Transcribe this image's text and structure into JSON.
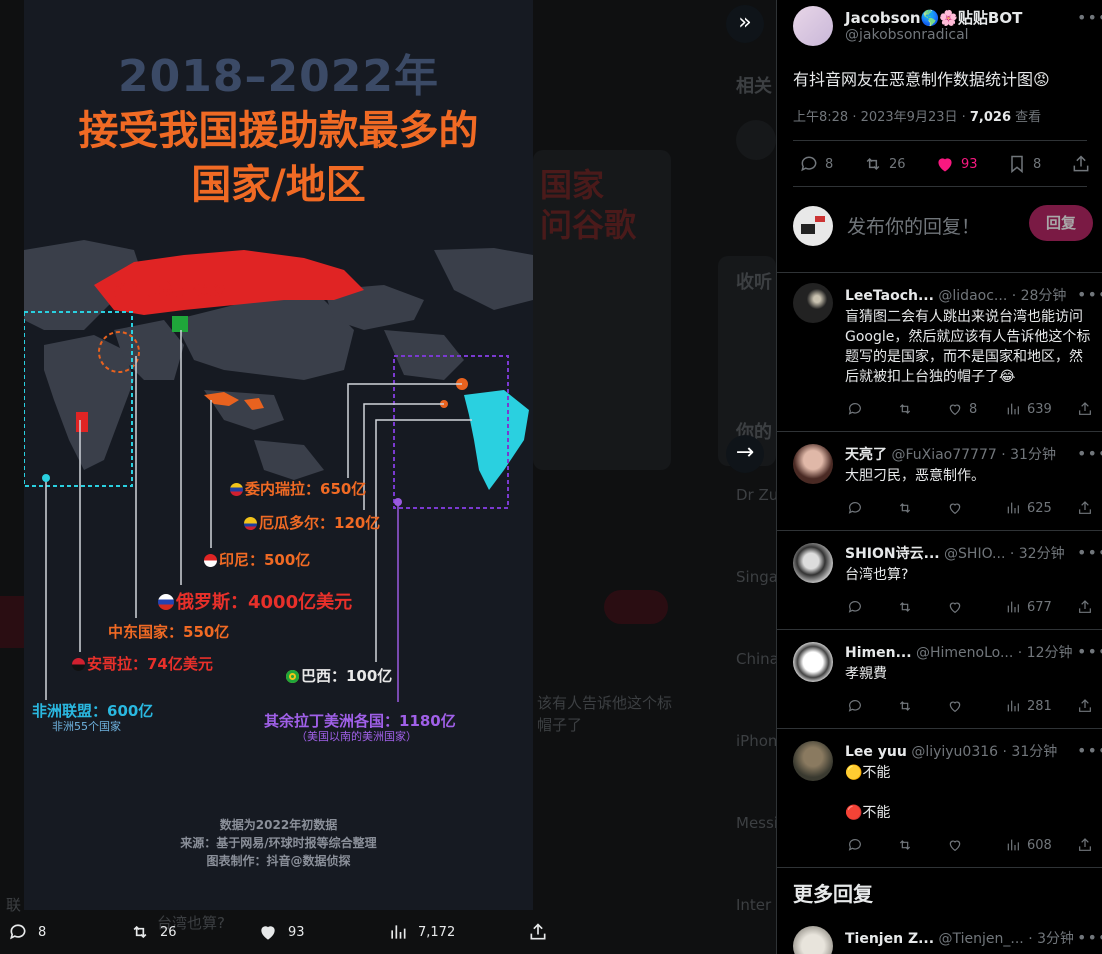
{
  "viewer": {
    "infographic": {
      "year": "2018–2022年",
      "title_line1": "接受我国援助款最多的",
      "title_line2": "国家/地区",
      "watermark": "抖音@数据侦探",
      "labels": {
        "venezuela": "委内瑞拉：650亿",
        "ecuador": "厄瓜多尔：120亿",
        "indonesia": "印尼：500亿",
        "russia": "俄罗斯：4000亿美元",
        "middle_east": "中东国家：550亿",
        "angola": "安哥拉：74亿美元",
        "brazil": "巴西：100亿",
        "africa": "非洲联盟：600亿",
        "africa_sub": "非洲55个国家",
        "latam": "其余拉丁美洲各国：1180亿",
        "latam_sub": "（美国以南的美洲国家）"
      },
      "footer": [
        "数据为2022年初数据",
        "来源：基于网易/环球时报等综合整理",
        "图表制作：抖音@数据侦探"
      ]
    },
    "actions": {
      "replies": "8",
      "reposts": "26",
      "likes": "93",
      "views": "7,172"
    },
    "background_texts": [
      "相关",
      "收听",
      "你的",
      "Dr Zu",
      "Singa",
      "China",
      "iPhon",
      "Messi",
      "Inter",
      "该有人告诉他这个标",
      "帽子了",
      "台湾也算?",
      "联"
    ]
  },
  "tweet": {
    "author_name": "Jacobson🌎🌸贴贴BOT",
    "author_handle": "@jakobsonradical",
    "text": "有抖音网友在恶意制作数据统计图😡",
    "time": "上午8:28 · 2023年9月23日 · ",
    "views_count": "7,026",
    "views_label": " 查看",
    "replies": "8",
    "reposts": "26",
    "likes": "93",
    "bookmarks": "8",
    "reply_placeholder": "发布你的回复！",
    "reply_button": "回复"
  },
  "replies": [
    {
      "name": "LeeTaoch...",
      "handle": "@lidaoc...",
      "time": "· 28分钟",
      "text": "盲猜图二会有人跳出来说台湾也能访问Google，然后就应该有人告诉他这个标题写的是国家，而不是国家和地区，然后就被扣上台独的帽子了😂",
      "likes": "8",
      "views": "639"
    },
    {
      "name": "天亮了",
      "handle": "@FuXiao77777",
      "time": "· 31分钟",
      "text": "大胆刁民，恶意制作。",
      "likes": "",
      "views": "625"
    },
    {
      "name": "SHION诗云...",
      "handle": "@SHIO...",
      "time": "· 32分钟",
      "text": "台湾也算?",
      "likes": "",
      "views": "677"
    },
    {
      "name": "Himen...",
      "handle": "@HimenoLo...",
      "time": "· 12分钟",
      "text": "孝親費",
      "likes": "",
      "views": "281"
    },
    {
      "name": "Lee yuu",
      "handle": "@liyiyu0316",
      "time": "· 31分钟",
      "text": "🟡不能",
      "text2": "🔴不能",
      "likes": "",
      "views": "608"
    }
  ],
  "more_replies": {
    "heading": "更多回复",
    "first": {
      "name": "Tienjen Z...",
      "handle": "@Tienjen_...",
      "time": "· 3分钟"
    }
  }
}
